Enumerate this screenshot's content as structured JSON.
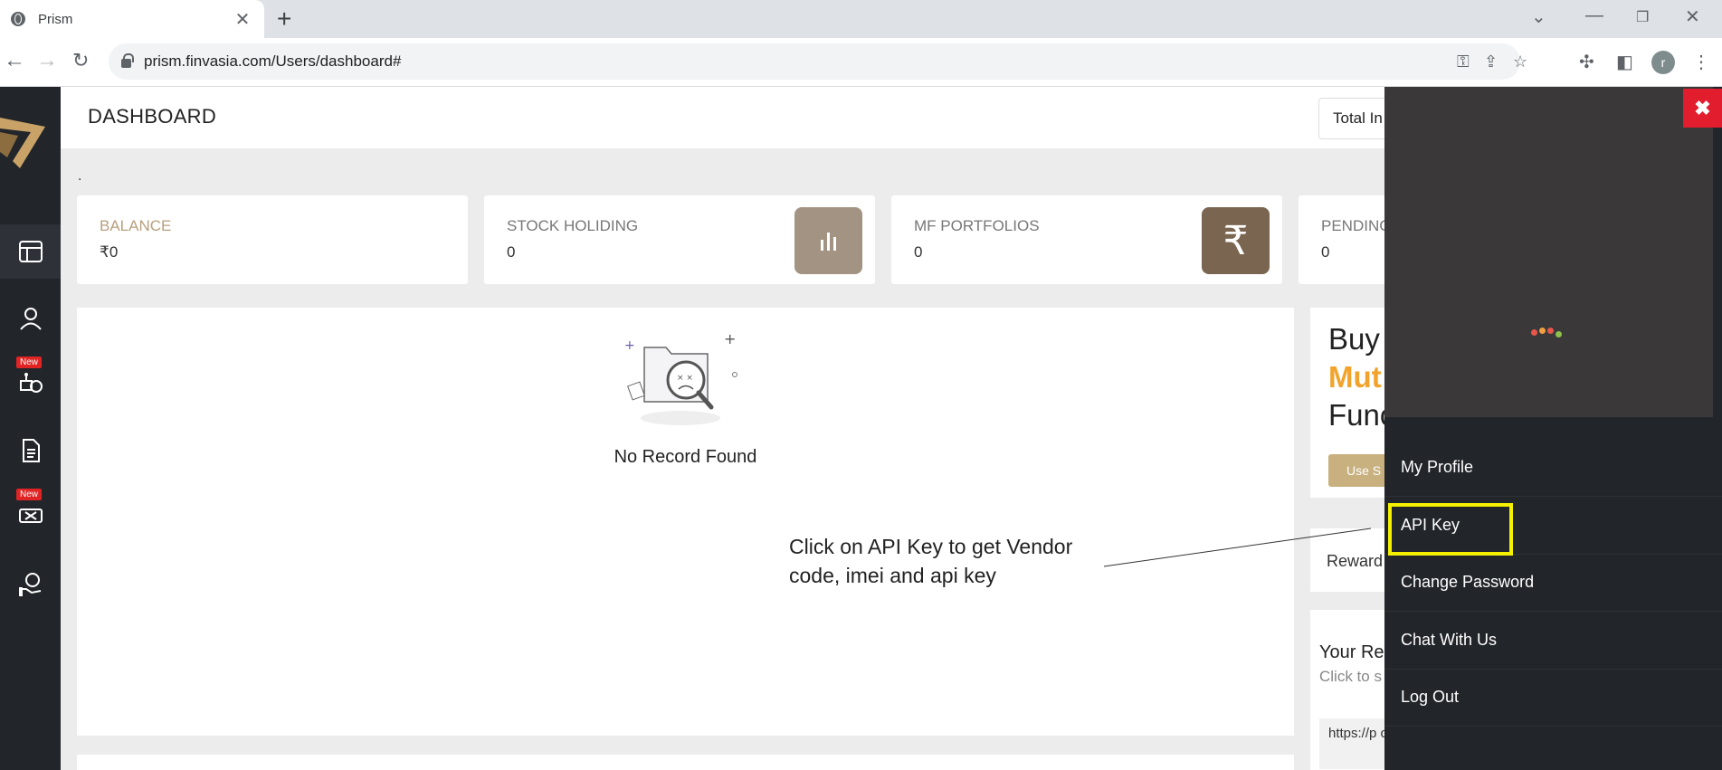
{
  "browser": {
    "tab_title": "Prism",
    "url": "prism.finvasia.com/Users/dashboard#",
    "profile_initial": "r"
  },
  "icons": {
    "favicon": "globe-icon",
    "omnibox": [
      "key-icon",
      "share-icon",
      "star-icon"
    ],
    "toolbar": [
      "puzzle-icon",
      "side-panel-icon",
      "menu-icon"
    ],
    "sidebar": [
      "dashboard-icon",
      "user-icon",
      "robot-icon",
      "document-icon",
      "tools-icon",
      "hand-people-icon"
    ]
  },
  "header": {
    "title": "DASHBOARD",
    "total_box": "Total In"
  },
  "stray_text": ".",
  "cards": [
    {
      "label": "BALANCE",
      "value": "₹0",
      "label_color": "#b8a07e"
    },
    {
      "label": "STOCK HOLIDING",
      "value": "0",
      "icon": "bar-chart-icon",
      "icon_bg": "#a39382"
    },
    {
      "label": "MF PORTFOLIOS",
      "value": "0",
      "icon": "rupee-icon",
      "icon_bg": "#7a6550",
      "icon_glyph": "₹"
    },
    {
      "label": "PENDING",
      "value": "0"
    }
  ],
  "main_panel": {
    "empty_text": "No Record Found"
  },
  "annotation": {
    "text": "Click on API Key to get Vendor code, imei and api key",
    "highlight_color": "#f5f000"
  },
  "right_col": {
    "buy_word": "Buy",
    "buy_accent": "Mut",
    "buy_rest": "Func",
    "buy_button": "Use S",
    "reward": "Reward",
    "referral_title": "Your Re",
    "referral_sub": "Click to s",
    "referral_link": "https://p chiseLe"
  },
  "sidebar": {
    "badge": "New"
  },
  "drawer": {
    "menu": [
      "My Profile",
      "API Key",
      "Change Password",
      "Chat With Us",
      "Log Out"
    ],
    "close_glyph": "✖",
    "loader_colors": [
      "#e8584a",
      "#f0a040",
      "#e8584a",
      "#8fc04c"
    ]
  },
  "colors": {
    "sidebar_bg": "#22252a",
    "drawer_bg": "#22252a",
    "accent_gold": "#f2a32c",
    "close_red": "#e11d2e"
  }
}
